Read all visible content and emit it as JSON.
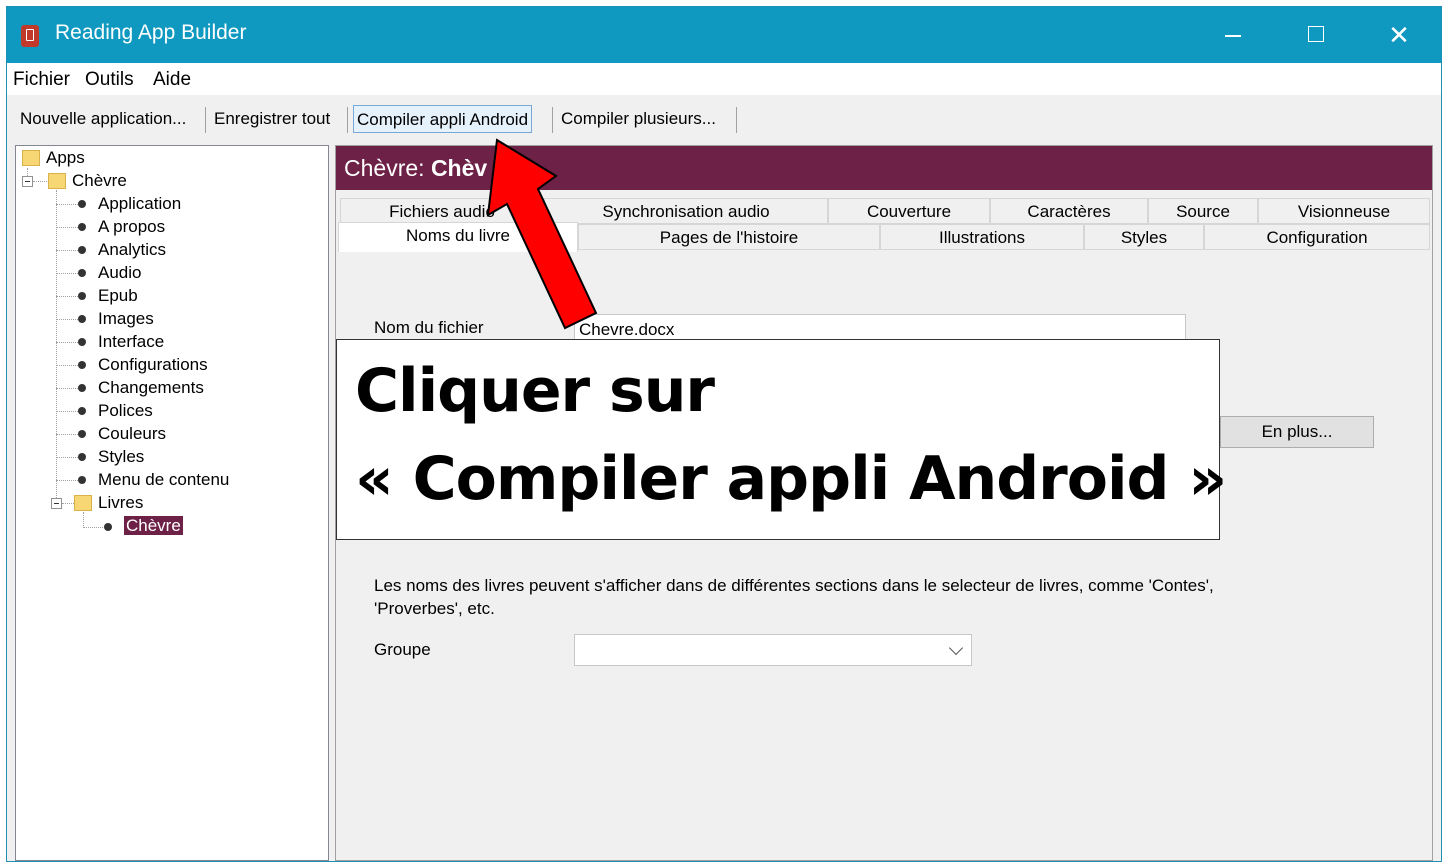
{
  "window": {
    "title": "Reading App Builder",
    "controls": {
      "close": "✕"
    }
  },
  "menu": {
    "items": [
      "Fichier",
      "Outils",
      "Aide"
    ]
  },
  "toolbar": {
    "buttons": [
      "Nouvelle application...",
      "Enregistrer tout",
      "Compiler appli Android",
      "Compiler plusieurs..."
    ]
  },
  "tree": {
    "root": "Apps",
    "app": "Chèvre",
    "items": [
      "Application",
      "A propos",
      "Analytics",
      "Audio",
      "Epub",
      "Images",
      "Interface",
      "Configurations",
      "Changements",
      "Polices",
      "Couleurs",
      "Styles",
      "Menu de contenu"
    ],
    "books_folder": "Livres",
    "book": "Chèvre"
  },
  "header": {
    "prefix": "Chèvre:",
    "bold": "Chèv"
  },
  "tabs": {
    "row1": [
      "Fichiers audio",
      "Synchronisation audio",
      "Couverture",
      "Caractères",
      "Source",
      "Visionneuse"
    ],
    "row2": [
      "Noms du livre",
      "Pages de l'histoire",
      "Illustrations",
      "Styles",
      "Configuration"
    ]
  },
  "form": {
    "filename_label": "Nom du fichier",
    "filename_value": "Chevre.docx",
    "more_button": "En plus...",
    "groups_help": "Les noms des livres peuvent s'afficher dans de différentes sections dans le selecteur de livres, comme 'Contes',",
    "groups_help_2": "'Proverbes', etc.",
    "group_label": "Groupe",
    "group_value": ""
  },
  "callout": {
    "line1": "Cliquer sur",
    "line2": "« Compiler appli Android »"
  },
  "colors": {
    "titlebar": "#0f99c0",
    "header": "#6d2146",
    "arrow": "#ff0000"
  }
}
